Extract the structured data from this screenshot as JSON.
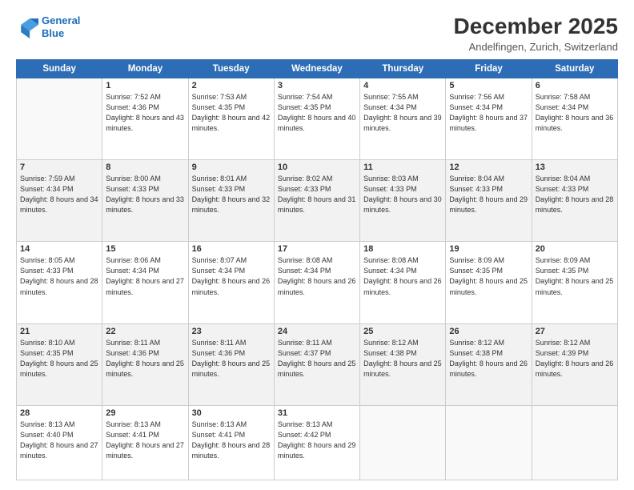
{
  "logo": {
    "line1": "General",
    "line2": "Blue"
  },
  "title": "December 2025",
  "subtitle": "Andelfingen, Zurich, Switzerland",
  "weekdays": [
    "Sunday",
    "Monday",
    "Tuesday",
    "Wednesday",
    "Thursday",
    "Friday",
    "Saturday"
  ],
  "weeks": [
    [
      {
        "day": "",
        "sunrise": "",
        "sunset": "",
        "daylight": ""
      },
      {
        "day": "1",
        "sunrise": "Sunrise: 7:52 AM",
        "sunset": "Sunset: 4:36 PM",
        "daylight": "Daylight: 8 hours and 43 minutes."
      },
      {
        "day": "2",
        "sunrise": "Sunrise: 7:53 AM",
        "sunset": "Sunset: 4:35 PM",
        "daylight": "Daylight: 8 hours and 42 minutes."
      },
      {
        "day": "3",
        "sunrise": "Sunrise: 7:54 AM",
        "sunset": "Sunset: 4:35 PM",
        "daylight": "Daylight: 8 hours and 40 minutes."
      },
      {
        "day": "4",
        "sunrise": "Sunrise: 7:55 AM",
        "sunset": "Sunset: 4:34 PM",
        "daylight": "Daylight: 8 hours and 39 minutes."
      },
      {
        "day": "5",
        "sunrise": "Sunrise: 7:56 AM",
        "sunset": "Sunset: 4:34 PM",
        "daylight": "Daylight: 8 hours and 37 minutes."
      },
      {
        "day": "6",
        "sunrise": "Sunrise: 7:58 AM",
        "sunset": "Sunset: 4:34 PM",
        "daylight": "Daylight: 8 hours and 36 minutes."
      }
    ],
    [
      {
        "day": "7",
        "sunrise": "Sunrise: 7:59 AM",
        "sunset": "Sunset: 4:34 PM",
        "daylight": "Daylight: 8 hours and 34 minutes."
      },
      {
        "day": "8",
        "sunrise": "Sunrise: 8:00 AM",
        "sunset": "Sunset: 4:33 PM",
        "daylight": "Daylight: 8 hours and 33 minutes."
      },
      {
        "day": "9",
        "sunrise": "Sunrise: 8:01 AM",
        "sunset": "Sunset: 4:33 PM",
        "daylight": "Daylight: 8 hours and 32 minutes."
      },
      {
        "day": "10",
        "sunrise": "Sunrise: 8:02 AM",
        "sunset": "Sunset: 4:33 PM",
        "daylight": "Daylight: 8 hours and 31 minutes."
      },
      {
        "day": "11",
        "sunrise": "Sunrise: 8:03 AM",
        "sunset": "Sunset: 4:33 PM",
        "daylight": "Daylight: 8 hours and 30 minutes."
      },
      {
        "day": "12",
        "sunrise": "Sunrise: 8:04 AM",
        "sunset": "Sunset: 4:33 PM",
        "daylight": "Daylight: 8 hours and 29 minutes."
      },
      {
        "day": "13",
        "sunrise": "Sunrise: 8:04 AM",
        "sunset": "Sunset: 4:33 PM",
        "daylight": "Daylight: 8 hours and 28 minutes."
      }
    ],
    [
      {
        "day": "14",
        "sunrise": "Sunrise: 8:05 AM",
        "sunset": "Sunset: 4:33 PM",
        "daylight": "Daylight: 8 hours and 28 minutes."
      },
      {
        "day": "15",
        "sunrise": "Sunrise: 8:06 AM",
        "sunset": "Sunset: 4:34 PM",
        "daylight": "Daylight: 8 hours and 27 minutes."
      },
      {
        "day": "16",
        "sunrise": "Sunrise: 8:07 AM",
        "sunset": "Sunset: 4:34 PM",
        "daylight": "Daylight: 8 hours and 26 minutes."
      },
      {
        "day": "17",
        "sunrise": "Sunrise: 8:08 AM",
        "sunset": "Sunset: 4:34 PM",
        "daylight": "Daylight: 8 hours and 26 minutes."
      },
      {
        "day": "18",
        "sunrise": "Sunrise: 8:08 AM",
        "sunset": "Sunset: 4:34 PM",
        "daylight": "Daylight: 8 hours and 26 minutes."
      },
      {
        "day": "19",
        "sunrise": "Sunrise: 8:09 AM",
        "sunset": "Sunset: 4:35 PM",
        "daylight": "Daylight: 8 hours and 25 minutes."
      },
      {
        "day": "20",
        "sunrise": "Sunrise: 8:09 AM",
        "sunset": "Sunset: 4:35 PM",
        "daylight": "Daylight: 8 hours and 25 minutes."
      }
    ],
    [
      {
        "day": "21",
        "sunrise": "Sunrise: 8:10 AM",
        "sunset": "Sunset: 4:35 PM",
        "daylight": "Daylight: 8 hours and 25 minutes."
      },
      {
        "day": "22",
        "sunrise": "Sunrise: 8:11 AM",
        "sunset": "Sunset: 4:36 PM",
        "daylight": "Daylight: 8 hours and 25 minutes."
      },
      {
        "day": "23",
        "sunrise": "Sunrise: 8:11 AM",
        "sunset": "Sunset: 4:36 PM",
        "daylight": "Daylight: 8 hours and 25 minutes."
      },
      {
        "day": "24",
        "sunrise": "Sunrise: 8:11 AM",
        "sunset": "Sunset: 4:37 PM",
        "daylight": "Daylight: 8 hours and 25 minutes."
      },
      {
        "day": "25",
        "sunrise": "Sunrise: 8:12 AM",
        "sunset": "Sunset: 4:38 PM",
        "daylight": "Daylight: 8 hours and 25 minutes."
      },
      {
        "day": "26",
        "sunrise": "Sunrise: 8:12 AM",
        "sunset": "Sunset: 4:38 PM",
        "daylight": "Daylight: 8 hours and 26 minutes."
      },
      {
        "day": "27",
        "sunrise": "Sunrise: 8:12 AM",
        "sunset": "Sunset: 4:39 PM",
        "daylight": "Daylight: 8 hours and 26 minutes."
      }
    ],
    [
      {
        "day": "28",
        "sunrise": "Sunrise: 8:13 AM",
        "sunset": "Sunset: 4:40 PM",
        "daylight": "Daylight: 8 hours and 27 minutes."
      },
      {
        "day": "29",
        "sunrise": "Sunrise: 8:13 AM",
        "sunset": "Sunset: 4:41 PM",
        "daylight": "Daylight: 8 hours and 27 minutes."
      },
      {
        "day": "30",
        "sunrise": "Sunrise: 8:13 AM",
        "sunset": "Sunset: 4:41 PM",
        "daylight": "Daylight: 8 hours and 28 minutes."
      },
      {
        "day": "31",
        "sunrise": "Sunrise: 8:13 AM",
        "sunset": "Sunset: 4:42 PM",
        "daylight": "Daylight: 8 hours and 29 minutes."
      },
      {
        "day": "",
        "sunrise": "",
        "sunset": "",
        "daylight": ""
      },
      {
        "day": "",
        "sunrise": "",
        "sunset": "",
        "daylight": ""
      },
      {
        "day": "",
        "sunrise": "",
        "sunset": "",
        "daylight": ""
      }
    ]
  ]
}
